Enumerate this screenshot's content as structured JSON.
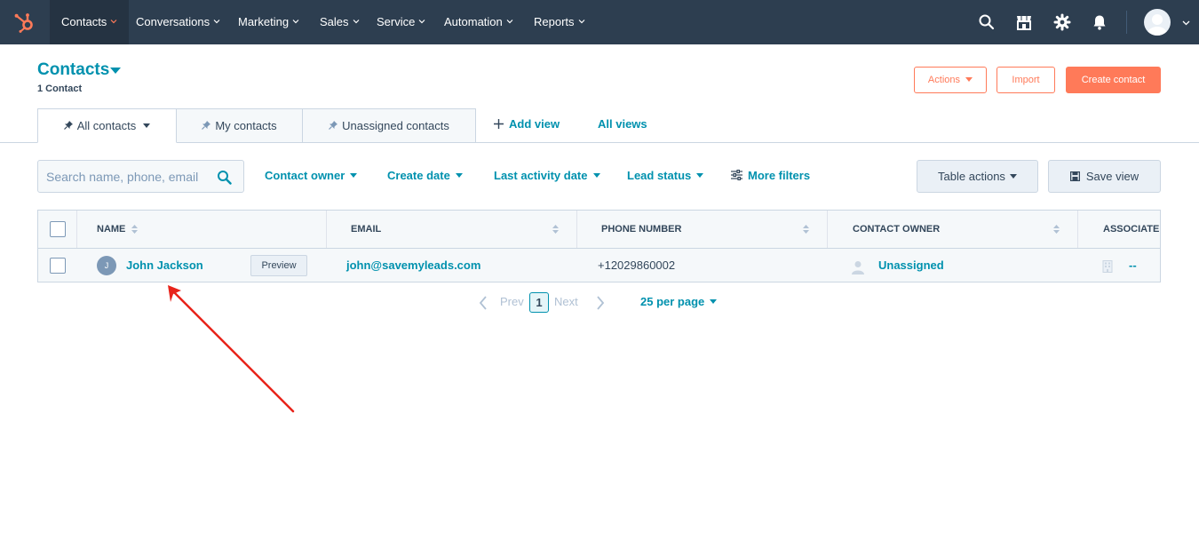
{
  "topnav": {
    "items": [
      {
        "label": "Contacts",
        "active": true
      },
      {
        "label": "Conversations"
      },
      {
        "label": "Marketing"
      },
      {
        "label": "Sales"
      },
      {
        "label": "Service"
      },
      {
        "label": "Automation"
      },
      {
        "label": "Reports"
      }
    ],
    "brand_color": "#ff7a59",
    "bg_color": "#2d3e50",
    "icons": [
      "search-icon",
      "marketplace-icon",
      "settings-gear-icon",
      "notifications-bell-icon"
    ]
  },
  "header": {
    "title": "Contacts",
    "record_count": "1 Contact",
    "actions_label": "Actions",
    "import_label": "Import",
    "create_label": "Create contact"
  },
  "tabs": [
    {
      "label": "All contacts",
      "active": true
    },
    {
      "label": "My contacts"
    },
    {
      "label": "Unassigned contacts"
    }
  ],
  "view_actions": {
    "add_view": "Add view",
    "all_views": "All views"
  },
  "filters": {
    "search_placeholder": "Search name, phone, email",
    "contact_owner": "Contact owner",
    "create_date": "Create date",
    "last_activity_date": "Last activity date",
    "lead_status": "Lead status",
    "more_filters": "More filters",
    "table_actions": "Table actions",
    "save_view": "Save view"
  },
  "table": {
    "columns": [
      "NAME",
      "EMAIL",
      "PHONE NUMBER",
      "CONTACT OWNER",
      "ASSOCIATED COMPANY"
    ],
    "rows": [
      {
        "avatar_initial": "J",
        "name": "John Jackson",
        "preview": "Preview",
        "email": "john@savemyleads.com",
        "phone": "+12029860002",
        "owner": "Unassigned",
        "company": "--"
      }
    ]
  },
  "pagination": {
    "prev": "Prev",
    "current_page": "1",
    "next": "Next",
    "per_page": "25 per page"
  },
  "colors": {
    "link": "#0091ae",
    "text": "#33475b",
    "accent": "#ff7a59",
    "annotation_arrow": "#e8231a"
  }
}
